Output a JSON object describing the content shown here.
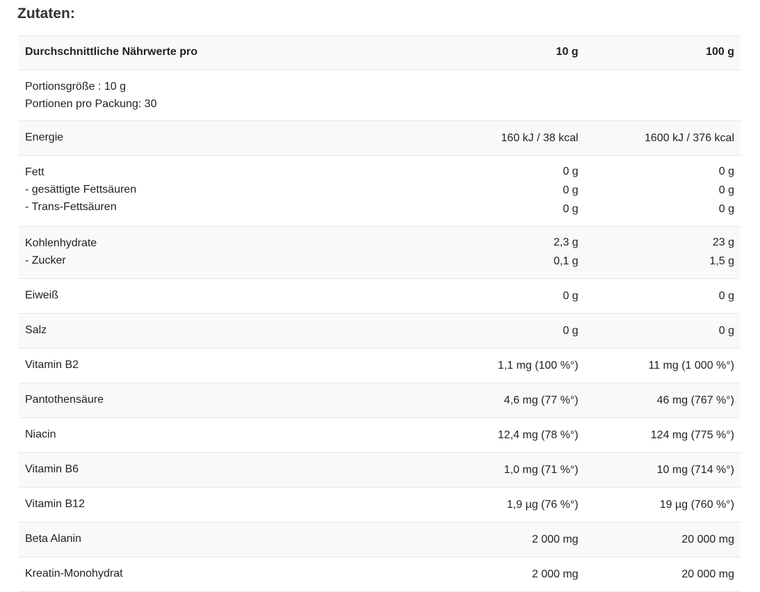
{
  "title": "Zutaten:",
  "table": {
    "header": {
      "label": "Durchschnittliche Nährwerte pro",
      "col1": "10 g",
      "col2": "100 g"
    },
    "serving": {
      "size": "Portionsgröße : 10 g",
      "portions": "Portionen pro Packung: 30"
    },
    "rows": [
      {
        "labels": [
          "Energie"
        ],
        "v1": [
          "160 kJ / 38 kcal"
        ],
        "v2": [
          "1600 kJ / 376 kcal"
        ]
      },
      {
        "labels": [
          "Fett",
          "- gesättigte Fettsäuren",
          "- Trans-Fettsäuren"
        ],
        "v1": [
          "0 g",
          "0 g",
          "0 g"
        ],
        "v2": [
          "0 g",
          "0 g",
          "0 g"
        ]
      },
      {
        "labels": [
          "Kohlenhydrate",
          "- Zucker"
        ],
        "v1": [
          "2,3 g",
          "0,1 g"
        ],
        "v2": [
          "23 g",
          "1,5 g"
        ]
      },
      {
        "labels": [
          "Eiweiß"
        ],
        "v1": [
          "0 g"
        ],
        "v2": [
          "0 g"
        ]
      },
      {
        "labels": [
          "Salz"
        ],
        "v1": [
          "0 g"
        ],
        "v2": [
          "0 g"
        ]
      },
      {
        "labels": [
          "Vitamin B2"
        ],
        "v1": [
          "1,1 mg (100 %°)"
        ],
        "v2": [
          "11 mg (1 000 %°)"
        ]
      },
      {
        "labels": [
          "Pantothensäure"
        ],
        "v1": [
          "4,6 mg (77 %°)"
        ],
        "v2": [
          "46 mg (767 %°)"
        ]
      },
      {
        "labels": [
          "Niacin"
        ],
        "v1": [
          "12,4 mg (78 %°)"
        ],
        "v2": [
          "124 mg (775 %°)"
        ]
      },
      {
        "labels": [
          "Vitamin B6"
        ],
        "v1": [
          "1,0 mg (71 %°)"
        ],
        "v2": [
          "10 mg (714 %°)"
        ]
      },
      {
        "labels": [
          "Vitamin B12"
        ],
        "v1": [
          "1,9 µg (76 %°)"
        ],
        "v2": [
          "19 µg (760 %°)"
        ]
      },
      {
        "labels": [
          "Beta Alanin"
        ],
        "v1": [
          "2 000 mg"
        ],
        "v2": [
          "20 000 mg"
        ]
      },
      {
        "labels": [
          "Kreatin-Monohydrat"
        ],
        "v1": [
          "2 000 mg"
        ],
        "v2": [
          "20 000 mg"
        ]
      }
    ]
  }
}
